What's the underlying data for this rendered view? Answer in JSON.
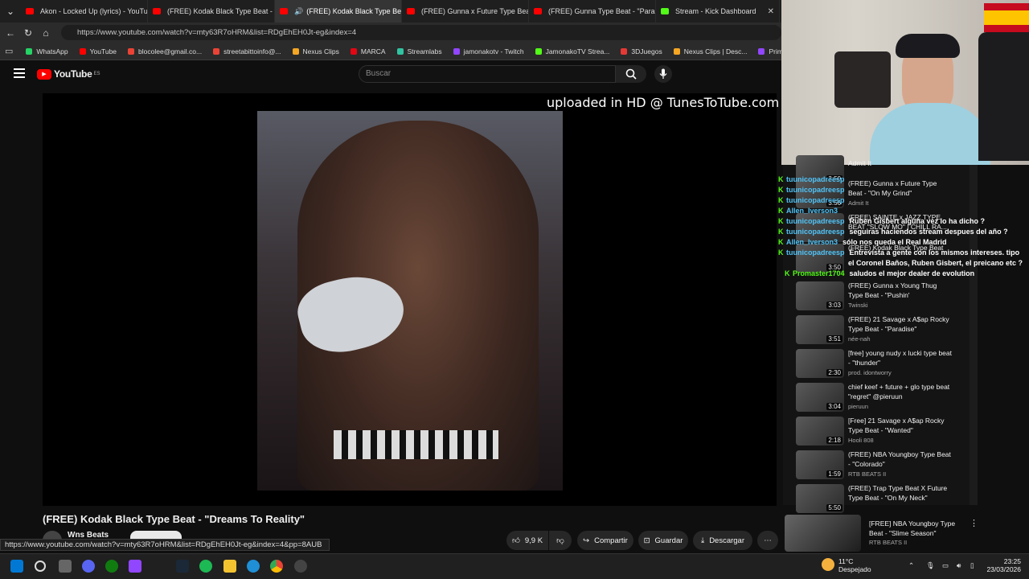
{
  "browser": {
    "tabs": [
      {
        "label": "Akon - Locked Up (lyrics) - YouTu",
        "icon": "youtube-icon"
      },
      {
        "label": "(FREE) Kodak Black Type Beat - \"Y",
        "icon": "youtube-icon"
      },
      {
        "label": "(FREE) Kodak Black Type Beat",
        "icon": "youtube-icon"
      },
      {
        "label": "(FREE) Gunna x Future Type Beat",
        "icon": "youtube-icon"
      },
      {
        "label": "(FREE) Gunna Type Beat - \"Paradi",
        "icon": "youtube-icon"
      },
      {
        "label": "Stream - Kick Dashboard",
        "icon": "kick-icon"
      }
    ],
    "url": "https://www.youtube.com/watch?v=mty63R7oHRM&list=RDgEhEH0Jt-eg&index=4",
    "bookmarks": [
      {
        "label": "WhatsApp",
        "color": "#25d366"
      },
      {
        "label": "YouTube",
        "color": "#ff0000"
      },
      {
        "label": "blocolee@gmail.co...",
        "color": "#ea4335"
      },
      {
        "label": "streetabittoinfo@...",
        "color": "#ea4335"
      },
      {
        "label": "Nexus Clips",
        "color": "#f5a623"
      },
      {
        "label": "MARCA",
        "color": "#e30613"
      },
      {
        "label": "Streamlabs",
        "color": "#31c3a2"
      },
      {
        "label": "jamonakotv - Twitch",
        "color": "#9146ff"
      },
      {
        "label": "JamonakoTV Strea...",
        "color": "#53fc18"
      },
      {
        "label": "3DJuegos",
        "color": "#e53935"
      },
      {
        "label": "Nexus Clips | Desc...",
        "color": "#f5a623"
      },
      {
        "label": "Prime",
        "color": "#9146ff"
      }
    ],
    "status_url": "https://www.youtube.com/watch?v=mty63R7oHRM&list=RDgEhEH0Jt-eg&index=4&pp=8AUB"
  },
  "youtube": {
    "logo": "YouTube",
    "region": "ES",
    "search_placeholder": "Buscar",
    "watermark": "uploaded in HD @ TunesToTube.com",
    "video_title": "(FREE) Kodak Black Type Beat - \"Dreams To Reality\"",
    "channel": "Wns Beats",
    "likes": "9,9 K",
    "share": "Compartir",
    "save": "Guardar",
    "download": "Descargar"
  },
  "chat": [
    {
      "user": "tuunicopadreesp",
      "msg": "",
      "color": "#4fc3f7"
    },
    {
      "user": "tuunicopadreesp",
      "msg": "",
      "color": "#4fc3f7"
    },
    {
      "user": "tuunicopadreesp",
      "msg": "",
      "color": "#4fc3f7"
    },
    {
      "user": "Allen_Iverson3",
      "msg": "",
      "color": "#4fc3f7"
    },
    {
      "user": "tuunicopadreesp",
      "msg": "Ruben Gisbert alguna vez lo ha dicho ?",
      "color": "#4fc3f7"
    },
    {
      "user": "tuunicopadreesp",
      "msg": "seguiras haciendos stream despues del año ?",
      "color": "#4fc3f7"
    },
    {
      "user": "Allen_Iverson3",
      "msg": "sólo nos queda el Real Madrid",
      "color": "#4fc3f7"
    },
    {
      "user": "tuunicopadreesp",
      "msg": "Entrevista a gente con los mismos intereses. tipo",
      "color": "#4fc3f7"
    },
    {
      "user": "",
      "msg": "el Coronel Baños, Ruben Gisbert, el preicano etc ?",
      "color": "#4fc3f7"
    },
    {
      "user": "Promaster1704",
      "msg": "saludos el mejor dealer de evolution",
      "color": "#53fc18"
    }
  ],
  "playlist": [
    {
      "title": "Admit It",
      "channel": "",
      "duration": "3:50"
    },
    {
      "title": "(FREE) Gunna x Future Type Beat - \"On My Grind\"",
      "channel": "Admit It",
      "duration": "3:56"
    },
    {
      "title": "(FREE) SAINTE x JAZZ TYPE BEAT \"SLOW MO\" | CHILL RA...",
      "channel": "",
      "duration": ""
    },
    {
      "title": "(FREE) Kodak Black Type Beat",
      "channel": "",
      "duration": "3:50"
    },
    {
      "title": "(FREE) Gunna x Young Thug Type Beat - \"Pushin'",
      "channel": "Twinski",
      "duration": "3:03"
    },
    {
      "title": "(FREE) 21 Savage x A$ap Rocky Type Beat - \"Paradise\"",
      "channel": "née-nah",
      "duration": "3:51"
    },
    {
      "title": "[free] young nudy x lucki type beat - \"thunder\"",
      "channel": "prod. idontworry",
      "duration": "2:30"
    },
    {
      "title": "chief keef + future + glo type beat \"regret\" @pieruun",
      "channel": "pieruun",
      "duration": "3:04"
    },
    {
      "title": "[Free] 21 Savage x A$ap Rocky Type Beat - \"Wanted\"",
      "channel": "Hooli 808",
      "duration": "2:18"
    },
    {
      "title": "(FREE) NBA Youngboy Type Beat - \"Colorado\"",
      "channel": "RTB BEATS II",
      "duration": "1:59"
    },
    {
      "title": "(FREE) Trap Type Beat X Future Type Beat - \"On My Neck\"",
      "channel": "",
      "duration": "5:50"
    }
  ],
  "next_video": {
    "title": "[FREE] NBA Youngboy Type Beat - \"Slime Season\"",
    "channel": "RTB BEATS II"
  },
  "taskbar": {
    "temp": "11°C",
    "weather": "Despejado",
    "time": "23:25",
    "date": "23/03/2026"
  }
}
